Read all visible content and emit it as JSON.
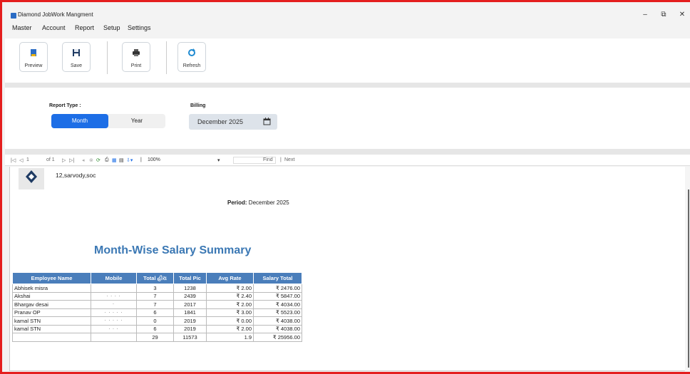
{
  "window": {
    "title": "Diamond JobWork Mangment",
    "controls": [
      "–",
      "⧉",
      "✕"
    ]
  },
  "menu": [
    "Master",
    "Account",
    "Report",
    "Setup",
    "Settings"
  ],
  "toolbar": {
    "preview": "Preview",
    "save": "Save",
    "print": "Print",
    "refresh": "Refresh"
  },
  "params": {
    "report_type_label": "Report Type :",
    "month": "Month",
    "year": "Year",
    "selected": "Month",
    "billing_label": "Billing",
    "billing_value": "December 2025"
  },
  "viewer": {
    "page_current": "1",
    "page_of": "of 1",
    "zoom": "100%",
    "find": "Find",
    "next": "Next"
  },
  "report": {
    "address": "12,sarvody,soc",
    "period_label": "Period:",
    "period_value": "December 2025",
    "title": "Month-Wise Salary Summary",
    "columns": [
      "Employee Name",
      "Mobile",
      "Total હીરા",
      "Total Pic",
      "Avg Rate",
      "Salary Total"
    ],
    "rows": [
      [
        "Abhisek misra",
        "",
        "3",
        "1238",
        "₹ 2.00",
        "₹ 2476.00"
      ],
      [
        "Akshai",
        "· · · ·",
        "7",
        "2439",
        "₹ 2.40",
        "₹ 5847.00"
      ],
      [
        "Bhargav desai",
        "·",
        "7",
        "2017",
        "₹ 2.00",
        "₹ 4034.00"
      ],
      [
        "Pranav OP",
        "· · · · ·",
        "6",
        "1841",
        "₹ 3.00",
        "₹ 5523.00"
      ],
      [
        "kamal STN",
        "· · · · ·",
        "0",
        "2019",
        "₹ 0.00",
        "₹ 4038.00"
      ],
      [
        "kamal STN",
        "· · ·",
        "6",
        "2019",
        "₹ 2.00",
        "₹ 4038.00"
      ]
    ],
    "totals": [
      "",
      "",
      "29",
      "11573",
      "1.9",
      "₹ 25956.00"
    ]
  },
  "colors": {
    "accent": "#1d6ee6",
    "header": "#4a7ebb",
    "title": "#3b78b4",
    "border": "#e41e1e"
  }
}
